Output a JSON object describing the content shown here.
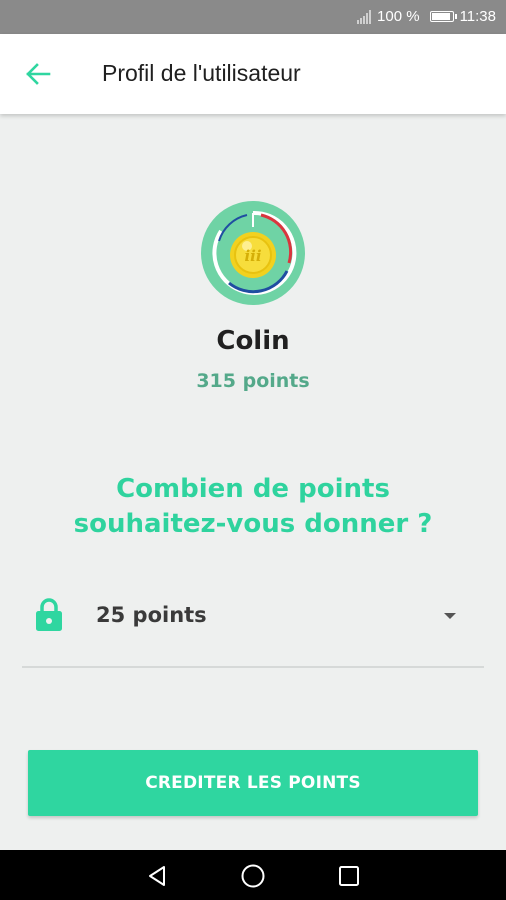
{
  "status_bar": {
    "battery_percent": "100 %",
    "time": "11:38"
  },
  "app_bar": {
    "title": "Profil de l'utilisateur",
    "back_icon": "arrow-left-icon"
  },
  "profile": {
    "name": "Colin",
    "points": "315 points",
    "avatar_icon": "coin-medal-icon",
    "avatar_coin_text": "iii"
  },
  "question": {
    "line1": "Combien de points",
    "line2": "souhaitez-vous donner ?"
  },
  "points_select": {
    "value": "25 points",
    "lock_icon": "lock-icon",
    "dropdown_icon": "dropdown-arrow-icon"
  },
  "actions": {
    "credit_label": "CREDITER LES POINTS"
  },
  "colors": {
    "accent": "#2fd6a0",
    "points_text": "#54a98a",
    "background": "#eef0ef"
  },
  "nav": {
    "back_icon": "nav-back-icon",
    "home_icon": "nav-home-icon",
    "recents_icon": "nav-recents-icon"
  }
}
